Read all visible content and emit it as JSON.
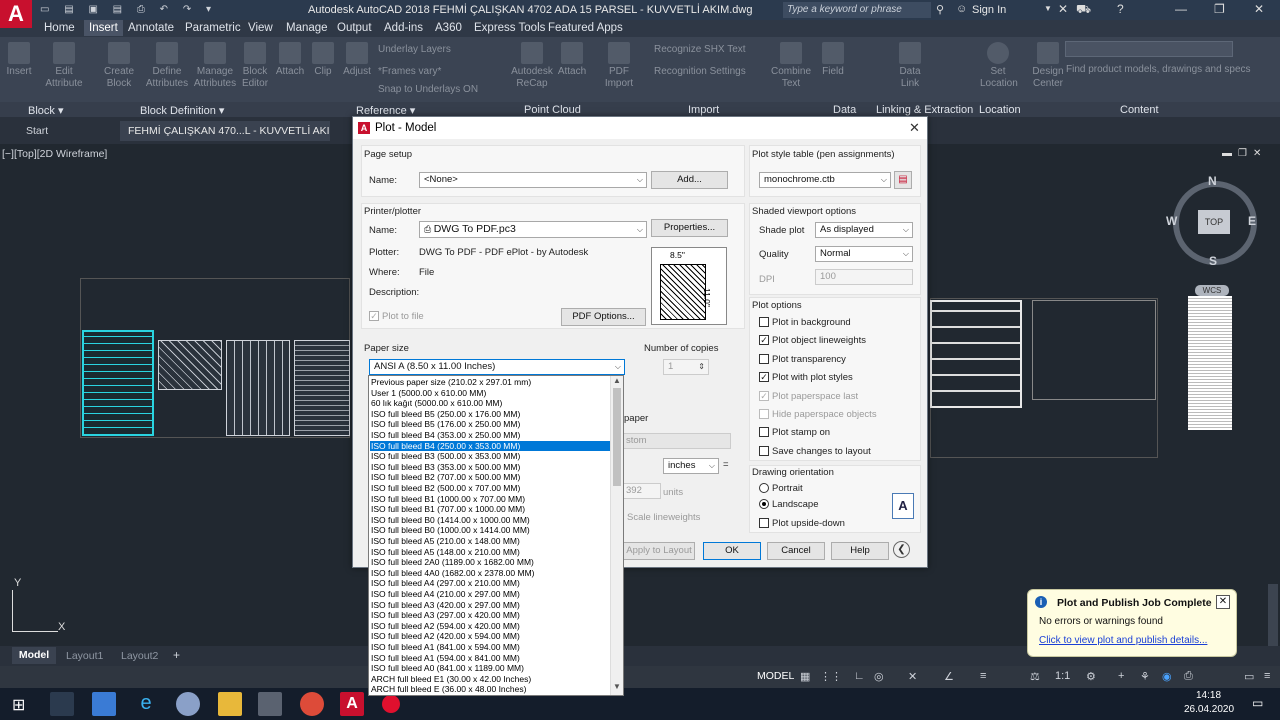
{
  "titlebar": {
    "title": "Autodesk AutoCAD 2018    FEHMİ ÇALIŞKAN 4702 ADA 15 PARSEL - KUVVETLİ AKIM.dwg",
    "search_placeholder": "Type a keyword or phrase",
    "sign_in": "Sign In"
  },
  "ribbon": {
    "tabs": [
      "Home",
      "Insert",
      "Annotate",
      "Parametric",
      "View",
      "Manage",
      "Output",
      "Add-ins",
      "A360",
      "Express Tools",
      "Featured Apps"
    ],
    "active_tab": "Insert",
    "buttons": {
      "insert": "Insert",
      "edit_attribute": "Edit Attribute",
      "create_block": "Create Block",
      "define_attributes": "Define Attributes",
      "manage_attributes": "Manage Attributes",
      "block_editor": "Block Editor",
      "attach": "Attach",
      "clip": "Clip",
      "adjust": "Adjust",
      "underlay_layers": "Underlay Layers",
      "frames_vary": "*Frames vary*",
      "snap_to_underlays": "Snap to Underlays ON",
      "autodesk_recap": "Autodesk ReCap",
      "attach2": "Attach",
      "pdf_import": "PDF Import",
      "recognize_shx": "Recognize SHX Text",
      "recognition_settings": "Recognition Settings",
      "combine_text": "Combine Text",
      "field": "Field",
      "data_link": "Data Link",
      "set_location": "Set Location",
      "design_center": "Design Center",
      "content_placeholder": "Find product models, drawings and specs"
    },
    "panels": [
      "Block ▾",
      "Block Definition ▾",
      "Reference ▾",
      "Point Cloud",
      "Import",
      "Data",
      "Linking & Extraction",
      "Location",
      "Content"
    ]
  },
  "doctabs": {
    "start": "Start",
    "doc": "FEHMİ ÇALIŞKAN 470...L - KUVVETLİ AKIM*"
  },
  "viewport": {
    "label": "[−][Top][2D Wireframe]",
    "viewcube_top": "TOP",
    "compass": {
      "n": "N",
      "s": "S",
      "e": "E",
      "w": "W"
    },
    "wcs": "WCS",
    "ucs_y": "Y",
    "ucs_x": "X"
  },
  "layout_tabs": [
    "Model",
    "Layout1",
    "Layout2"
  ],
  "status": {
    "model": "MODEL",
    "scale": "1:1"
  },
  "dialog": {
    "title": "Plot - Model",
    "page_setup": {
      "header": "Page setup",
      "name_label": "Name:",
      "name_value": "<None>",
      "add_button": "Add..."
    },
    "printer": {
      "header": "Printer/plotter",
      "name_label": "Name:",
      "name_value": "DWG To PDF.pc3",
      "properties_button": "Properties...",
      "plotter_label": "Plotter:",
      "plotter_value": "DWG To PDF - PDF ePlot - by Autodesk",
      "where_label": "Where:",
      "where_value": "File",
      "description_label": "Description:",
      "plot_to_file": "Plot to file",
      "pdf_options_button": "PDF Options...",
      "preview_width": "8.5\"",
      "preview_height": "11.0\""
    },
    "paper_size": {
      "header": "Paper size",
      "value": "ANSI A (8.50 x 11.00 Inches)"
    },
    "copies": {
      "header": "Number of copies",
      "value": "1"
    },
    "hidden_row": {
      "paper_label": "paper",
      "custom": "stom",
      "inches": "inches",
      "equals": "=",
      "units_value": "392",
      "units": "units",
      "scale_lineweights": "Scale lineweights"
    },
    "plot_style_table": {
      "header": "Plot style table (pen assignments)",
      "value": "monochrome.ctb"
    },
    "shaded": {
      "header": "Shaded viewport options",
      "shade_plot_label": "Shade plot",
      "shade_plot_value": "As displayed",
      "quality_label": "Quality",
      "quality_value": "Normal",
      "dpi_label": "DPI",
      "dpi_value": "100"
    },
    "plot_options": {
      "header": "Plot options",
      "items": [
        {
          "label": "Plot in background",
          "checked": false,
          "disabled": false
        },
        {
          "label": "Plot object lineweights",
          "checked": true,
          "disabled": false
        },
        {
          "label": "Plot transparency",
          "checked": false,
          "disabled": false
        },
        {
          "label": "Plot with plot styles",
          "checked": true,
          "disabled": false
        },
        {
          "label": "Plot paperspace last",
          "checked": true,
          "disabled": true
        },
        {
          "label": "Hide paperspace objects",
          "checked": false,
          "disabled": true
        },
        {
          "label": "Plot stamp on",
          "checked": false,
          "disabled": false
        },
        {
          "label": "Save changes to layout",
          "checked": false,
          "disabled": false
        }
      ]
    },
    "orientation": {
      "header": "Drawing orientation",
      "portrait": "Portrait",
      "landscape": "Landscape",
      "upside_down": "Plot upside-down",
      "selected": "Landscape"
    },
    "buttons": {
      "apply": "Apply to Layout",
      "ok": "OK",
      "cancel": "Cancel",
      "help": "Help"
    }
  },
  "paper_dropdown": {
    "selected_index": 6,
    "items": [
      "Previous paper size  (210.02 x 297.01 mm)",
      "User 1 (5000.00 x 610.00 MM)",
      "60 lık kağıt  (5000.00 x 610.00 MM)",
      "ISO full bleed B5 (250.00 x 176.00 MM)",
      "ISO full bleed B5 (176.00 x 250.00 MM)",
      "ISO full bleed B4 (353.00 x 250.00 MM)",
      "ISO full bleed B4 (250.00 x 353.00 MM)",
      "ISO full bleed B3 (500.00 x 353.00 MM)",
      "ISO full bleed B3 (353.00 x 500.00 MM)",
      "ISO full bleed B2 (707.00 x 500.00 MM)",
      "ISO full bleed B2 (500.00 x 707.00 MM)",
      "ISO full bleed B1 (1000.00 x 707.00 MM)",
      "ISO full bleed B1 (707.00 x 1000.00 MM)",
      "ISO full bleed B0 (1414.00 x 1000.00 MM)",
      "ISO full bleed B0 (1000.00 x 1414.00 MM)",
      "ISO full bleed A5 (210.00 x 148.00 MM)",
      "ISO full bleed A5 (148.00 x 210.00 MM)",
      "ISO full bleed 2A0 (1189.00 x 1682.00 MM)",
      "ISO full bleed 4A0 (1682.00 x 2378.00 MM)",
      "ISO full bleed A4 (297.00 x 210.00 MM)",
      "ISO full bleed A4 (210.00 x 297.00 MM)",
      "ISO full bleed A3 (420.00 x 297.00 MM)",
      "ISO full bleed A3 (297.00 x 420.00 MM)",
      "ISO full bleed A2 (594.00 x 420.00 MM)",
      "ISO full bleed A2 (420.00 x 594.00 MM)",
      "ISO full bleed A1 (841.00 x 594.00 MM)",
      "ISO full bleed A1 (594.00 x 841.00 MM)",
      "ISO full bleed A0 (841.00 x 1189.00 MM)",
      "ARCH full bleed E1 (30.00 x 42.00 Inches)",
      "ARCH full bleed E (36.00 x 48.00 Inches)"
    ]
  },
  "notification": {
    "title": "Plot and Publish Job Complete",
    "message": "No errors or warnings found",
    "link": "Click to view plot and publish details..."
  },
  "taskbar": {
    "time": "14:18",
    "date": "26.04.2020"
  },
  "colors": {
    "selection": "#0078d7",
    "ribbon": "#3b4453",
    "canvas": "#212830",
    "cyan_drawing": "#2ad4e0"
  }
}
